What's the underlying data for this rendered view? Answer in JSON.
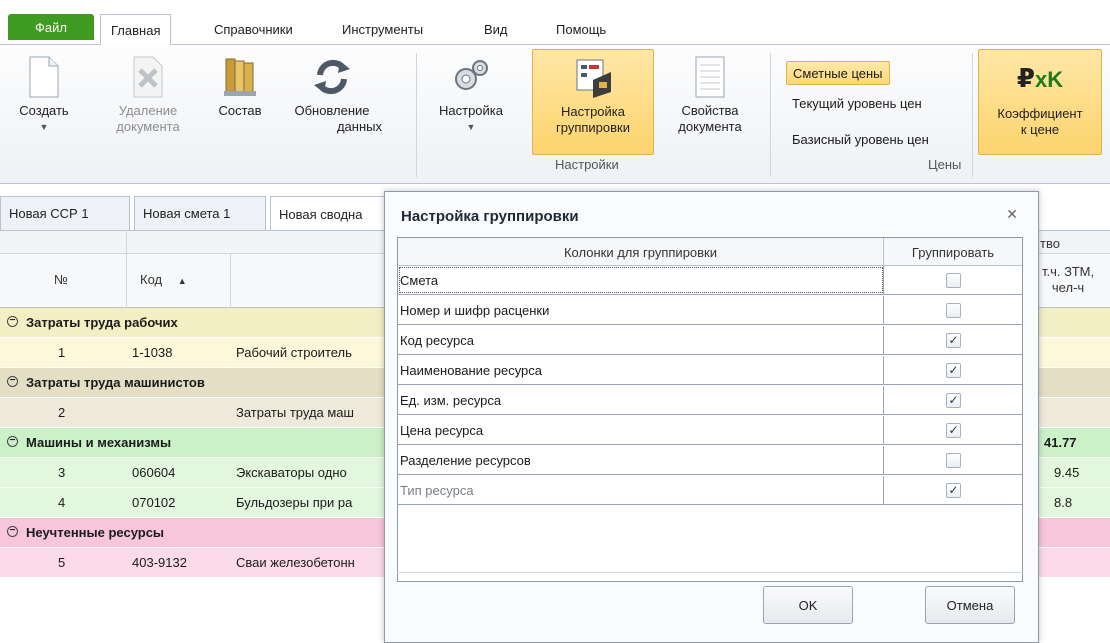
{
  "menu": {
    "file": "Файл",
    "tabs": [
      "Главная",
      "Справочники",
      "Инструменты",
      "Вид",
      "Помощь"
    ]
  },
  "ribbon": {
    "create": "Создать",
    "delete_line1": "Удаление",
    "delete_line2": "документа",
    "composition": "Состав",
    "refresh_line1": "Обновление",
    "refresh_line2": "данных",
    "settings": "Настройка",
    "group_settings_line1": "Настройка",
    "group_settings_line2": "группировки",
    "doc_props_line1": "Свойства",
    "doc_props_line2": "документа",
    "settings_group_label": "Настройки",
    "prices": {
      "estimated": "Сметные цены",
      "current": "Текущий уровень цен",
      "base": "Базисный уровень цен",
      "group_label": "Цены"
    },
    "coef_line1": "Коэффициент",
    "coef_line2": "к цене",
    "coef_icon_text": "₽",
    "coef_icon_sub": "xK"
  },
  "doc_tabs": [
    "Новая ССР 1",
    "Новая смета 1",
    "Новая сводна"
  ],
  "grid": {
    "header_top_right": "тво",
    "col_no": "№",
    "col_code": "Код",
    "col_ztm_line1": "т.ч. ЗТМ,",
    "col_ztm_line2": "чел-ч",
    "rows": [
      {
        "kind": "group",
        "label": "Затраты труда рабочих",
        "color": "#f3efc4"
      },
      {
        "kind": "item",
        "no": "1",
        "code": "1-1038",
        "name": "Рабочий строитель",
        "value": "",
        "color": "#fcf8d9"
      },
      {
        "kind": "group",
        "label": "Затраты труда машинистов",
        "color": "#e3dec4"
      },
      {
        "kind": "item",
        "no": "2",
        "code": "",
        "name": "Затраты труда маш",
        "value": "",
        "color": "#eeeadb"
      },
      {
        "kind": "group",
        "label": "Машины и механизмы",
        "color": "#ccf0c8",
        "value": "41.77"
      },
      {
        "kind": "item",
        "no": "3",
        "code": "060604",
        "name": "Экскаваторы одно",
        "value": "9.45",
        "color": "#e2f7de"
      },
      {
        "kind": "item",
        "no": "4",
        "code": "070102",
        "name": "Бульдозеры при ра",
        "value": "8.8",
        "color": "#e2f7de"
      },
      {
        "kind": "group",
        "label": "Неучтенные ресурсы",
        "color": "#f7c6da"
      },
      {
        "kind": "item",
        "no": "5",
        "code": "403-9132",
        "name": "Сваи железобетонн",
        "value": "",
        "color": "#fbdbe8"
      }
    ]
  },
  "dialog": {
    "title": "Настройка группировки",
    "close_glyph": "✕",
    "col_name": "Колонки для группировки",
    "col_group": "Группировать",
    "rows": [
      {
        "label": "Смета",
        "checked": false,
        "dim": false
      },
      {
        "label": "Номер и шифр расценки",
        "checked": false,
        "dim": false
      },
      {
        "label": "Код ресурса",
        "checked": true,
        "dim": false
      },
      {
        "label": "Наименование ресурса",
        "checked": true,
        "dim": false
      },
      {
        "label": "Ед. изм. ресурса",
        "checked": true,
        "dim": false
      },
      {
        "label": "Цена ресурса",
        "checked": true,
        "dim": false
      },
      {
        "label": "Разделение ресурсов",
        "checked": false,
        "dim": false
      },
      {
        "label": "Тип ресурса",
        "checked": true,
        "dim": true
      }
    ],
    "ok": "OK",
    "cancel": "Отмена"
  },
  "colors": {
    "file_tab": "#3f9b1f",
    "highlight": "#fdd46e",
    "accent_coef": "#1f7a1f"
  }
}
